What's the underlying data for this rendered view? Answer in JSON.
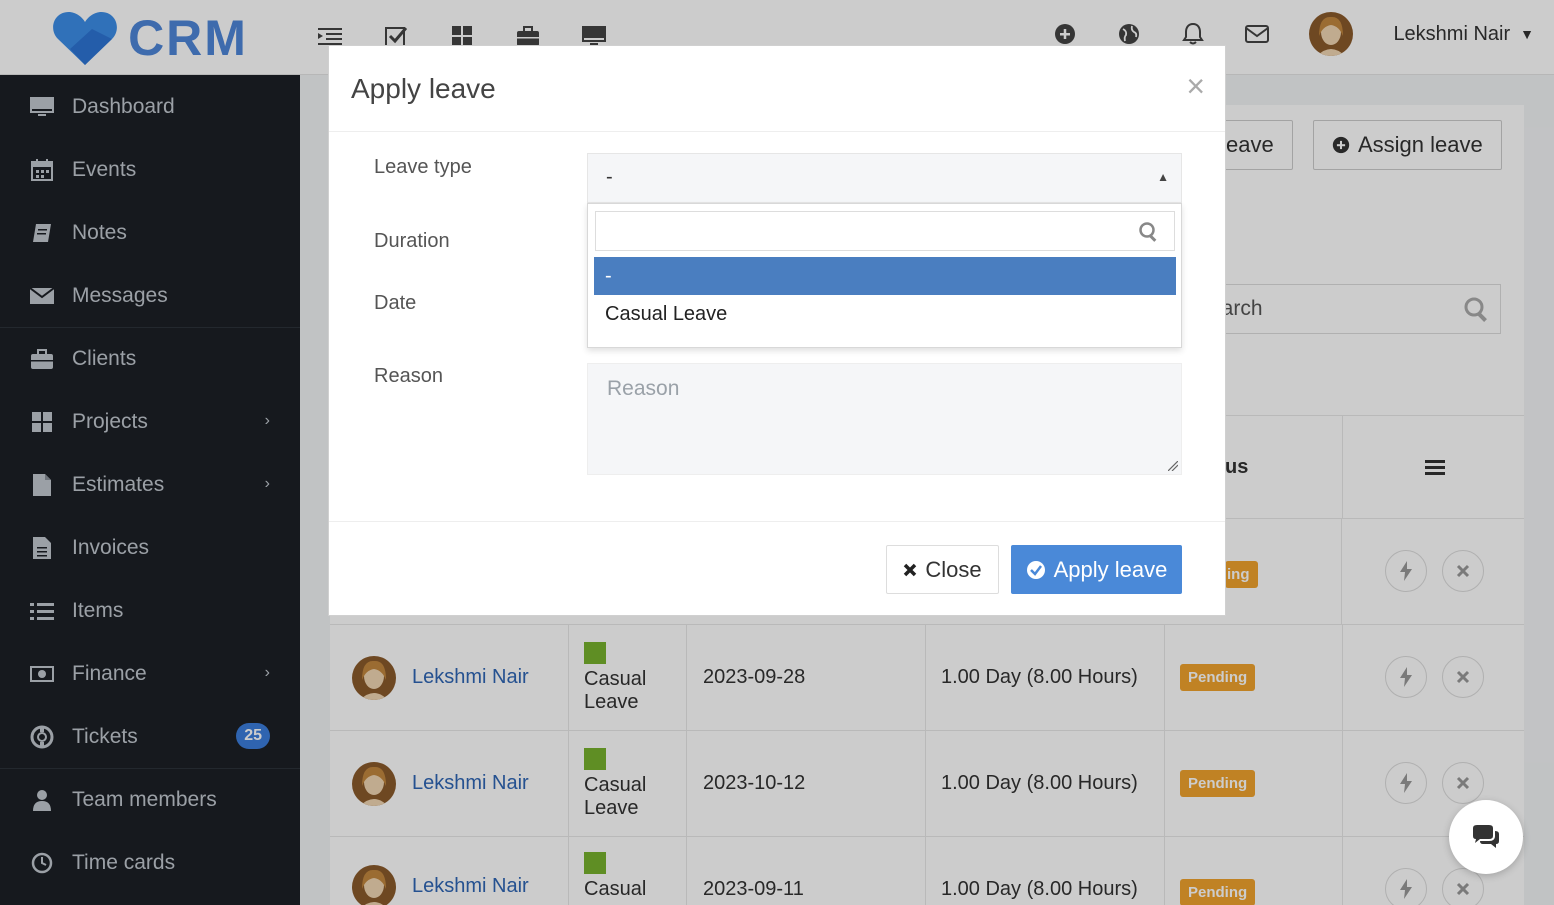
{
  "app": {
    "logo_text": "CRM",
    "brand_color": "#4e86d9"
  },
  "topbar": {
    "icons": [
      "list-indent-icon",
      "checkbox-icon",
      "grid-icon",
      "briefcase-icon",
      "monitor-icon"
    ],
    "right_icons": [
      "plus-circle-icon",
      "globe-icon",
      "bell-icon",
      "envelope-icon"
    ],
    "user_name": "Lekshmi Nair"
  },
  "sidebar": {
    "items": [
      {
        "label": "Dashboard",
        "icon": "monitor-icon"
      },
      {
        "label": "Events",
        "icon": "calendar-icon"
      },
      {
        "label": "Notes",
        "icon": "book-icon"
      },
      {
        "label": "Messages",
        "icon": "envelope-icon"
      },
      {
        "label": "Clients",
        "icon": "briefcase-icon"
      },
      {
        "label": "Projects",
        "icon": "grid-icon"
      },
      {
        "label": "Estimates",
        "icon": "file-icon"
      },
      {
        "label": "Invoices",
        "icon": "file-text-icon"
      },
      {
        "label": "Items",
        "icon": "list-icon"
      },
      {
        "label": "Finance",
        "icon": "money-icon"
      },
      {
        "label": "Tickets",
        "icon": "lifebuoy-icon",
        "badge": "25"
      },
      {
        "label": "Team members",
        "icon": "user-icon"
      },
      {
        "label": "Time cards",
        "icon": "clock-icon"
      }
    ]
  },
  "page": {
    "apply_leave_btn_partial": "eave",
    "assign_leave_btn": "Assign leave",
    "search_placeholder_partial": "earch",
    "status_col_partial": "us",
    "first_row_badge_partial": "ing",
    "rows": [
      {
        "name": "Lekshmi Nair",
        "type_line1": "Casual",
        "type_line2": "Leave",
        "date": "2023-09-28",
        "duration": "1.00 Day (8.00 Hours)",
        "status": "Pending"
      },
      {
        "name": "Lekshmi Nair",
        "type_line1": "Casual",
        "type_line2": "Leave",
        "date": "2023-10-12",
        "duration": "1.00 Day (8.00 Hours)",
        "status": "Pending"
      },
      {
        "name": "Lekshmi Nair",
        "type_line1": "Casual",
        "type_line2": "",
        "date": "2023-09-11",
        "duration": "1.00 Day (8.00 Hours)",
        "status": "Pending"
      }
    ]
  },
  "modal": {
    "title": "Apply leave",
    "close_symbol": "×",
    "labels": {
      "leave_type": "Leave type",
      "duration": "Duration",
      "date": "Date",
      "reason": "Reason"
    },
    "leave_type_value": "-",
    "dropdown": {
      "search_value": "",
      "options": [
        {
          "label": "-",
          "selected": true
        },
        {
          "label": "Casual Leave",
          "selected": false
        }
      ]
    },
    "reason_placeholder": "Reason",
    "footer": {
      "close_label": "Close",
      "apply_label": "Apply leave"
    }
  },
  "colors": {
    "primary": "#4a89d8",
    "pending": "#f0a32e",
    "leave_swatch": "#77b22e",
    "sidebar_bg": "#1c2026"
  }
}
